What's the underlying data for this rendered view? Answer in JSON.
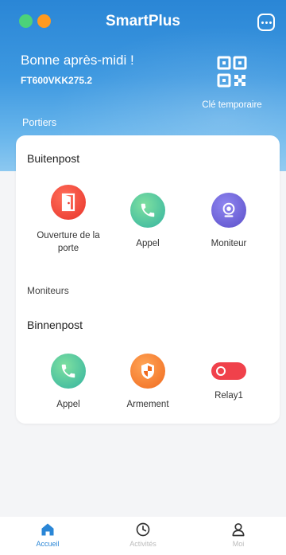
{
  "app": {
    "title": "SmartPlus"
  },
  "header": {
    "greeting": "Bonne après-midi !",
    "device_id": "FT600VKK275.2",
    "temp_key_label": "Clé temporaire",
    "section_label": "Portiers"
  },
  "outdoor": {
    "title": "Buitenpost",
    "actions": [
      {
        "label": "Ouverture de la porte",
        "icon": "door-open-icon"
      },
      {
        "label": "Appel",
        "icon": "phone-icon"
      },
      {
        "label": "Moniteur",
        "icon": "camera-icon"
      }
    ]
  },
  "monitors": {
    "label": "Moniteurs",
    "title": "Binnenpost",
    "actions": [
      {
        "label": "Appel",
        "icon": "phone-icon"
      },
      {
        "label": "Armement",
        "icon": "shield-icon"
      },
      {
        "label": "Relay1",
        "icon": "toggle-icon"
      }
    ]
  },
  "tabs": [
    {
      "label": "Accueil",
      "icon": "home-icon",
      "active": true
    },
    {
      "label": "Activités",
      "icon": "clock-icon",
      "active": false
    },
    {
      "label": "Moi",
      "icon": "user-icon",
      "active": false
    }
  ],
  "colors": {
    "header_blue": "#2a86d6",
    "door_red": "#e8332a",
    "call_green": "#33b3a0",
    "monitor_purple": "#5b4fc9",
    "arm_orange": "#f06a1e",
    "relay_red": "#f0414b",
    "window_green": "#4bd27a",
    "window_orange": "#ff9a1f"
  }
}
